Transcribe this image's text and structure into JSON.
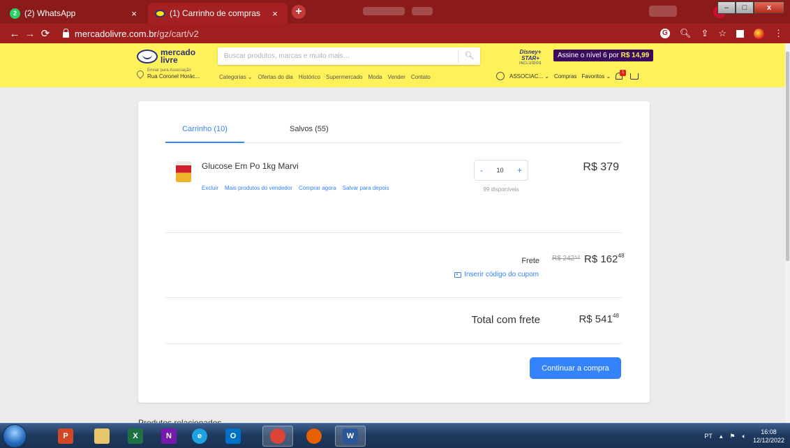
{
  "browser": {
    "tabs": [
      {
        "badge": "2",
        "title": "(2) WhatsApp"
      },
      {
        "title": "(1) Carrinho de compras"
      }
    ],
    "close_glyph": "×",
    "new_tab_glyph": "+",
    "url_domain": "mercadolivre.com.br",
    "url_path": "/gz/cart/v2",
    "window_buttons": {
      "minimize": "–",
      "maximize": "□",
      "close": "x"
    }
  },
  "header": {
    "logo_line1": "mercado",
    "logo_line2": "livre",
    "search_placeholder": "Buscar produtos, marcas e muito mais…",
    "disney_line1": "Disney+ STAR+",
    "disney_line2": "INCLUÍDOS",
    "promo_text": "Assine o nível 6 por ",
    "promo_price": "R$ 14,99",
    "location_small": "Enviar para Associação",
    "location_big": "Rua Coronel Horác...",
    "nav": [
      "Categorias ⌄",
      "Ofertas do dia",
      "Histórico",
      "Supermercado",
      "Moda",
      "Vender",
      "Contato"
    ],
    "user_name": "ASSOCIAC... ⌄",
    "purchases": "Compras",
    "favorites": "Favoritos ⌄",
    "notif_count": "1"
  },
  "cart": {
    "tab_cart": "Carrinho (10)",
    "tab_saved": "Salvos (55)",
    "item": {
      "title": "Glucose Em Po 1kg Marvi",
      "actions": [
        "Excluir",
        "Mais produtos do vendedor",
        "Comprar agora",
        "Salvar para depois"
      ],
      "quantity": "10",
      "minus": "-",
      "plus": "+",
      "available": "99 disponíveis",
      "price": "R$ 379"
    },
    "shipping_label": "Frete",
    "shipping_old": "R$ 242⁵⁰",
    "shipping_new": "R$ 162",
    "shipping_new_cents": "48",
    "coupon_text": "Inserir código do cupom",
    "total_label": "Total com frete",
    "total_value": "R$ 541",
    "total_cents": "48",
    "continue_button": "Continuar a compra"
  },
  "below": {
    "heading": "Produtos relacionados"
  },
  "taskbar": {
    "apps": [
      {
        "icon": "powerpoint-icon",
        "letter": "P",
        "color": "#d24726"
      },
      {
        "icon": "file-explorer-icon",
        "letter": "",
        "color": "#e8c46a"
      },
      {
        "icon": "excel-icon",
        "letter": "X",
        "color": "#1e7145"
      },
      {
        "icon": "onenote-icon",
        "letter": "N",
        "color": "#7719aa"
      },
      {
        "icon": "internet-explorer-icon",
        "letter": "e",
        "color": "#1ea1e1"
      },
      {
        "icon": "outlook-icon",
        "letter": "O",
        "color": "#0072c6"
      },
      {
        "icon": "chrome-icon",
        "letter": "",
        "color": "#db4437"
      },
      {
        "icon": "firefox-icon",
        "letter": "",
        "color": "#e66000"
      },
      {
        "icon": "word-icon",
        "letter": "W",
        "color": "#2b579a"
      }
    ],
    "lang": "PT",
    "time": "16:08",
    "date": "12/12/2022"
  }
}
